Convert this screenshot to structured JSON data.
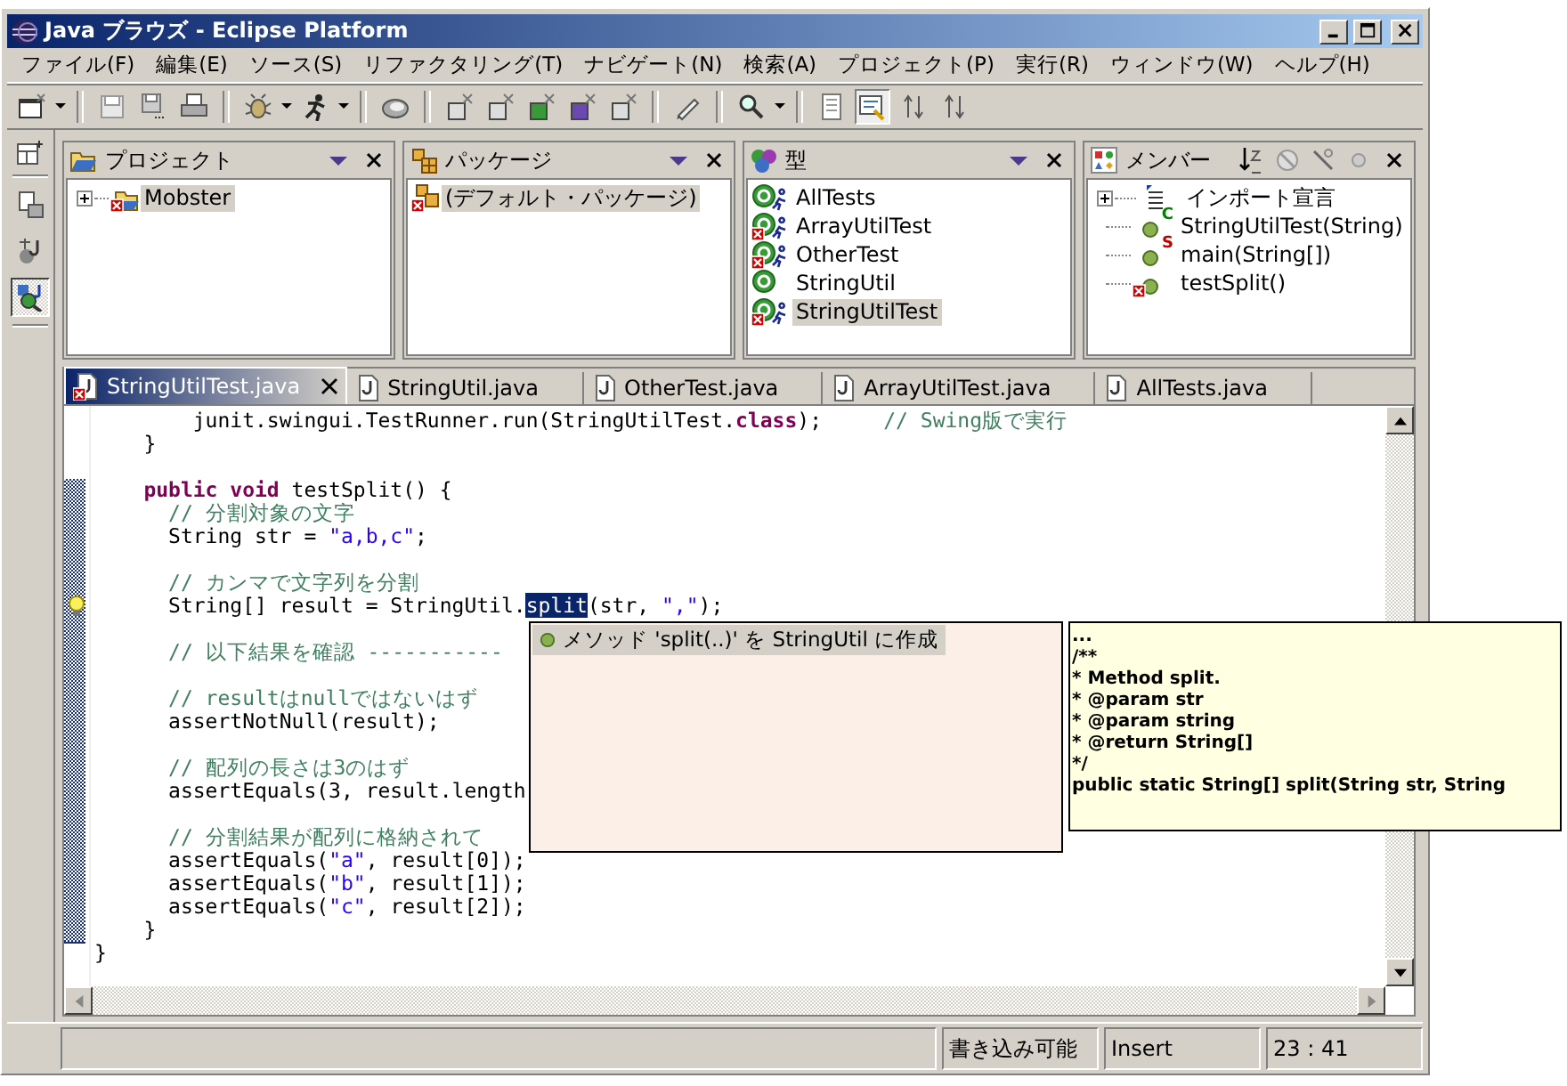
{
  "window": {
    "title": "Java ブラウズ - Eclipse Platform"
  },
  "menu": [
    "ファイル(F)",
    "編集(E)",
    "ソース(S)",
    "リファクタリング(T)",
    "ナビゲート(N)",
    "検索(A)",
    "プロジェクト(P)",
    "実行(R)",
    "ウィンドウ(W)",
    "ヘルプ(H)"
  ],
  "perspectives": [
    {
      "selected": false
    },
    {
      "selected": false
    },
    {
      "selected": true
    }
  ],
  "views": {
    "project": {
      "title": "プロジェクト",
      "items": [
        {
          "label": "Mobster",
          "expanded": false,
          "error": true,
          "selected": true
        }
      ]
    },
    "package": {
      "title": "パッケージ",
      "items": [
        {
          "label": "(デフォルト・パッケージ)",
          "error": true,
          "selected": true
        }
      ]
    },
    "types": {
      "title": "型",
      "items": [
        {
          "label": "AllTests",
          "error": false,
          "runnable": true,
          "selected": false
        },
        {
          "label": "ArrayUtilTest",
          "error": true,
          "runnable": true,
          "selected": false
        },
        {
          "label": "OtherTest",
          "error": true,
          "runnable": true,
          "selected": false
        },
        {
          "label": "StringUtil",
          "error": false,
          "runnable": false,
          "selected": false
        },
        {
          "label": "StringUtilTest",
          "error": true,
          "runnable": true,
          "selected": true
        }
      ]
    },
    "members": {
      "title": "メンバー",
      "items": [
        {
          "kind": "imports",
          "label": "インポート宣言",
          "expanded": false
        },
        {
          "kind": "method",
          "label": "StringUtilTest(String)",
          "badge": "C",
          "color": "#008000",
          "error": false
        },
        {
          "kind": "method",
          "label": "main(String[])",
          "badge": "S",
          "color": "#c00000",
          "error": false
        },
        {
          "kind": "method",
          "label": "testSplit()",
          "error": true
        }
      ]
    }
  },
  "editor": {
    "tabs": [
      {
        "label": "StringUtilTest.java",
        "selected": true,
        "error": true
      },
      {
        "label": "StringUtil.java",
        "selected": false,
        "error": false
      },
      {
        "label": "OtherTest.java",
        "selected": false,
        "error": false
      },
      {
        "label": "ArrayUtilTest.java",
        "selected": false,
        "error": false
      },
      {
        "label": "AllTests.java",
        "selected": false,
        "error": false
      }
    ],
    "lines": [
      {
        "segments": [
          {
            "kind": "plain",
            "text": "        junit.swingui.TestRunner.run(StringUtilTest."
          },
          {
            "kind": "keyword",
            "text": "class"
          },
          {
            "kind": "plain",
            "text": ");     "
          },
          {
            "kind": "comment",
            "text": "// Swing版で実行"
          }
        ]
      },
      {
        "segments": [
          {
            "kind": "plain",
            "text": "    }"
          }
        ]
      },
      {
        "space_before": true,
        "segments": [
          {
            "kind": "keyword",
            "text": "    public void"
          },
          {
            "kind": "plain",
            "text": " testSplit() {"
          }
        ]
      },
      {
        "segments": [
          {
            "kind": "comment",
            "text": "      // 分割対象の文字"
          }
        ]
      },
      {
        "segments": [
          {
            "kind": "plain",
            "text": "      String str = "
          },
          {
            "kind": "string",
            "text": "\"a,b,c\""
          },
          {
            "kind": "plain",
            "text": ";"
          }
        ]
      },
      {
        "space_before": true,
        "segments": [
          {
            "kind": "comment",
            "text": "      // カンマで文字列を分割"
          }
        ]
      },
      {
        "quick_fix": true,
        "segments": [
          {
            "kind": "plain",
            "text": "      String[] result = StringUtil."
          },
          {
            "kind": "selected",
            "text": "split"
          },
          {
            "kind": "plain",
            "text": "(str, "
          },
          {
            "kind": "string",
            "text": "\",\""
          },
          {
            "kind": "plain",
            "text": ");"
          }
        ]
      },
      {
        "space_before": true,
        "segments": [
          {
            "kind": "comment",
            "text": "      // 以下結果を確認 -----------"
          }
        ]
      },
      {
        "space_before": true,
        "segments": [
          {
            "kind": "comment",
            "text": "      // resultはnullではないはず"
          }
        ]
      },
      {
        "segments": [
          {
            "kind": "plain",
            "text": "      assertNotNull(result);"
          }
        ]
      },
      {
        "space_before": true,
        "segments": [
          {
            "kind": "comment",
            "text": "      // 配列の長さは3のはず"
          }
        ]
      },
      {
        "segments": [
          {
            "kind": "plain",
            "text": "      assertEquals(3, result.length"
          }
        ]
      },
      {
        "space_before": true,
        "segments": [
          {
            "kind": "comment",
            "text": "      // 分割結果が配列に格納されて"
          }
        ]
      },
      {
        "segments": [
          {
            "kind": "plain",
            "text": "      assertEquals("
          },
          {
            "kind": "string",
            "text": "\"a\""
          },
          {
            "kind": "plain",
            "text": ", result[0]);"
          }
        ]
      },
      {
        "segments": [
          {
            "kind": "plain",
            "text": "      assertEquals("
          },
          {
            "kind": "string",
            "text": "\"b\""
          },
          {
            "kind": "plain",
            "text": ", result[1]);"
          }
        ]
      },
      {
        "segments": [
          {
            "kind": "plain",
            "text": "      assertEquals("
          },
          {
            "kind": "string",
            "text": "\"c\""
          },
          {
            "kind": "plain",
            "text": ", result[2]);"
          }
        ]
      },
      {
        "segments": [
          {
            "kind": "plain",
            "text": "    }"
          }
        ]
      },
      {
        "segments": [
          {
            "kind": "plain",
            "text": "}"
          }
        ]
      }
    ],
    "quick_fix": {
      "items": [
        {
          "label": "メソッド  'split(..)' を StringUtil に作成",
          "selected": true
        }
      ]
    },
    "javadoc": {
      "lines": [
        "...",
        "/**",
        "* Method split.",
        "* @param str",
        "* @param string",
        "* @return String[]",
        "*/",
        "public static String[] split(String str, String"
      ]
    }
  },
  "status_bar": {
    "mode": "書き込み可能",
    "insert": "Insert",
    "position": "23 : 41"
  }
}
